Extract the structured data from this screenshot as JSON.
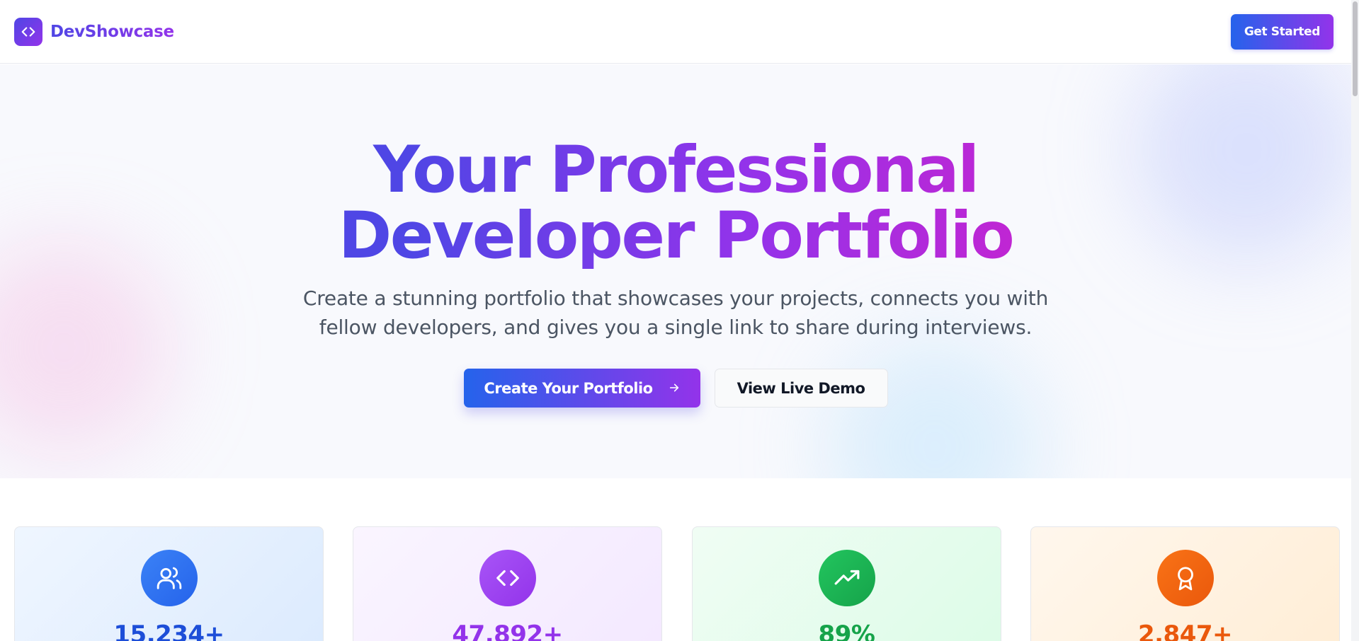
{
  "header": {
    "brand_name": "DevShowcase",
    "logo_icon": "code-brackets-icon",
    "cta_label": "Get Started"
  },
  "hero": {
    "title_line1": "Your Professional",
    "title_line2": "Developer Portfolio",
    "subtitle": "Create a stunning portfolio that showcases your projects, connects you with fellow developers, and gives you a single link to share during interviews.",
    "primary_cta": "Create Your Portfolio",
    "primary_cta_icon": "arrow-right-icon",
    "secondary_cta": "View Live Demo"
  },
  "stats": [
    {
      "value": "15,234+",
      "icon": "users-icon",
      "color": "#2563eb"
    },
    {
      "value": "47,892+",
      "icon": "code-brackets-icon",
      "color": "#9333ea"
    },
    {
      "value": "89%",
      "icon": "trending-up-icon",
      "color": "#16a34a"
    },
    {
      "value": "2,847+",
      "icon": "award-icon",
      "color": "#ea580c"
    }
  ],
  "colors": {
    "brand_start": "#4f46e5",
    "brand_end": "#9333ea",
    "hero_bg": "#f8f9fd"
  }
}
